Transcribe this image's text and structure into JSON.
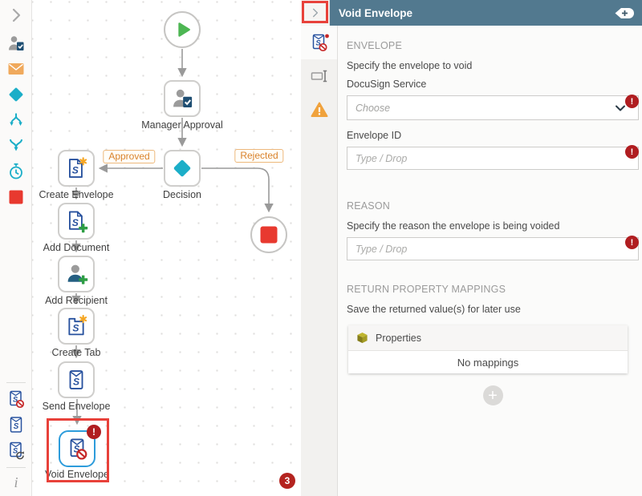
{
  "left_toolbar": {
    "icons": [
      "chevron-right",
      "user-task",
      "email",
      "decision",
      "split-paths",
      "merge-paths",
      "timer",
      "end",
      "void-envelope",
      "send-envelope",
      "envelope-refresh",
      "info"
    ]
  },
  "canvas": {
    "labels": {
      "manager_approval": "Manager Approval",
      "decision": "Decision",
      "create_envelope": "Create Envelope",
      "add_document": "Add Document",
      "add_recipient": "Add Recipient",
      "create_tab": "Create Tab",
      "send_envelope": "Send Envelope",
      "void_envelope": "Void Envelope"
    },
    "branches": {
      "approved": "Approved",
      "rejected": "Rejected"
    },
    "error_count": "3"
  },
  "panel": {
    "title": "Void Envelope",
    "tabs": [
      {
        "icon": "void-envelope-icon",
        "selected": true
      },
      {
        "icon": "rename-icon",
        "selected": false
      },
      {
        "icon": "warning-icon",
        "selected": false
      }
    ],
    "envelope_section": {
      "heading": "ENVELOPE",
      "description": "Specify the envelope to void",
      "service_label": "DocuSign Service",
      "service_placeholder": "Choose",
      "id_label": "Envelope ID",
      "id_placeholder": "Type / Drop"
    },
    "reason_section": {
      "heading": "REASON",
      "description": "Specify the reason the envelope is being voided",
      "placeholder": "Type / Drop"
    },
    "mappings_section": {
      "heading": "RETURN PROPERTY MAPPINGS",
      "description": "Save the returned value(s) for later use",
      "properties_label": "Properties",
      "empty_text": "No mappings"
    }
  },
  "colors": {
    "header_teal": "#52798F",
    "accent_teal": "#1BAEC8",
    "icon_navy": "#27519E",
    "error_red": "#B01D20",
    "annotation_red": "#E8413A",
    "branch_orange": "#D9822B",
    "stop_red": "#E8392F",
    "start_green": "#4DB653"
  }
}
